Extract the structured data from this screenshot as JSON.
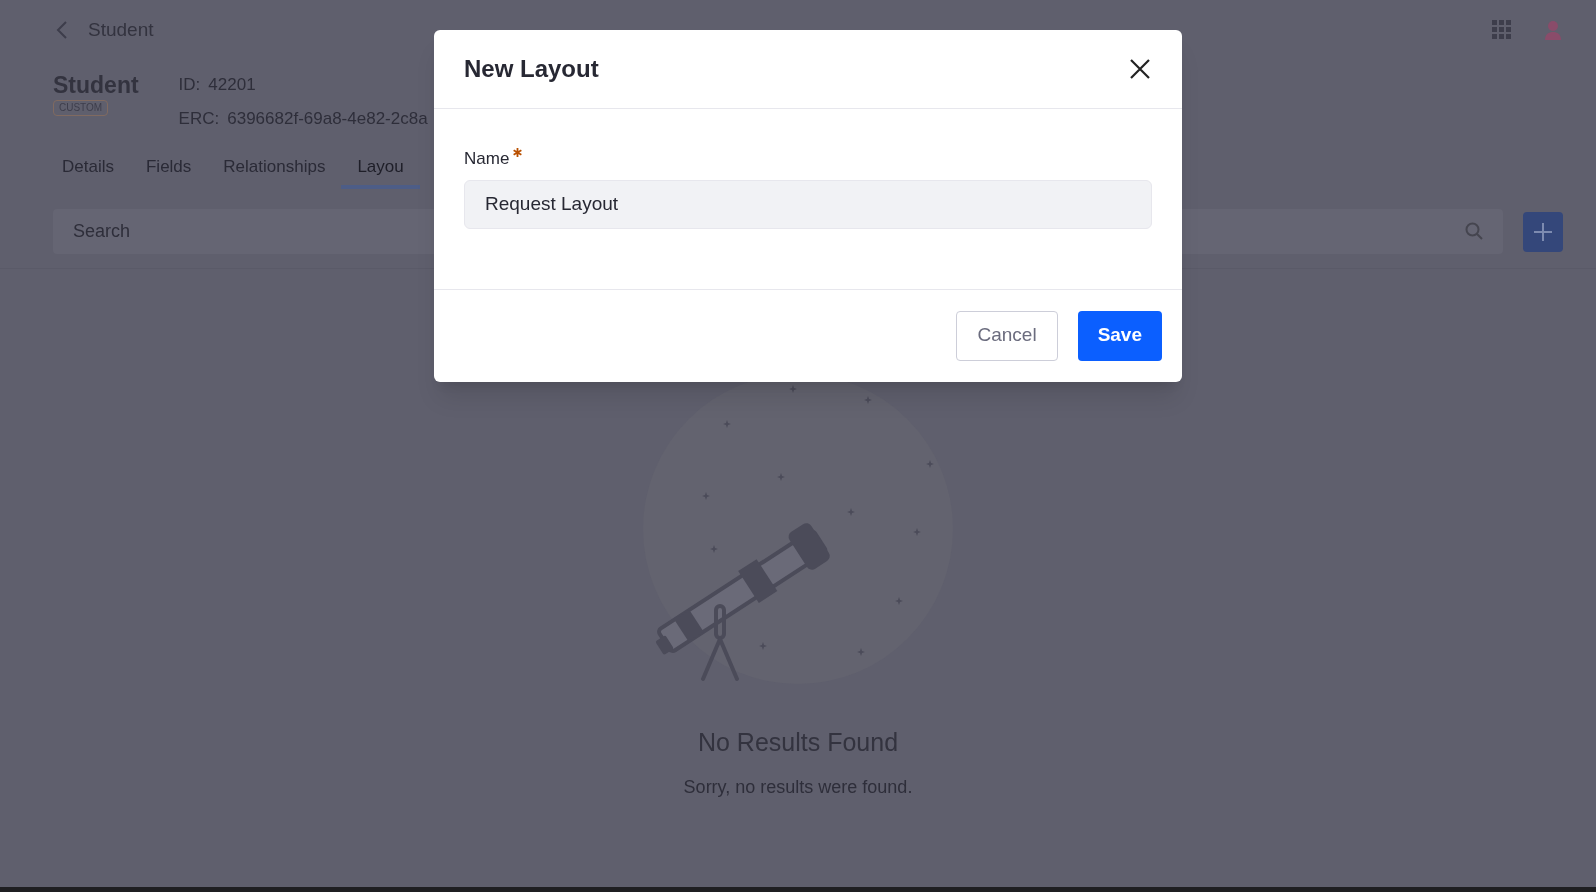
{
  "header": {
    "title": "Student"
  },
  "object": {
    "name": "Student",
    "badge": "CUSTOM",
    "id_label": "ID:",
    "id_value": "42201",
    "erc_label": "ERC:",
    "erc_value": "6396682f-69a8-4e82-2c8a"
  },
  "tabs": [
    {
      "label": "Details",
      "selected": false
    },
    {
      "label": "Fields",
      "selected": false
    },
    {
      "label": "Relationships",
      "selected": false
    },
    {
      "label": "Layou",
      "selected": true
    }
  ],
  "search": {
    "placeholder": "Search"
  },
  "empty_state": {
    "title": "No Results Found",
    "message": "Sorry, no results were found."
  },
  "dialog": {
    "title": "New Layout",
    "field": {
      "label": "Name",
      "required": true,
      "value": "Request Layout"
    },
    "buttons": [
      {
        "label": "Cancel",
        "kind": "secondary"
      },
      {
        "label": "Save",
        "kind": "primary"
      }
    ]
  }
}
